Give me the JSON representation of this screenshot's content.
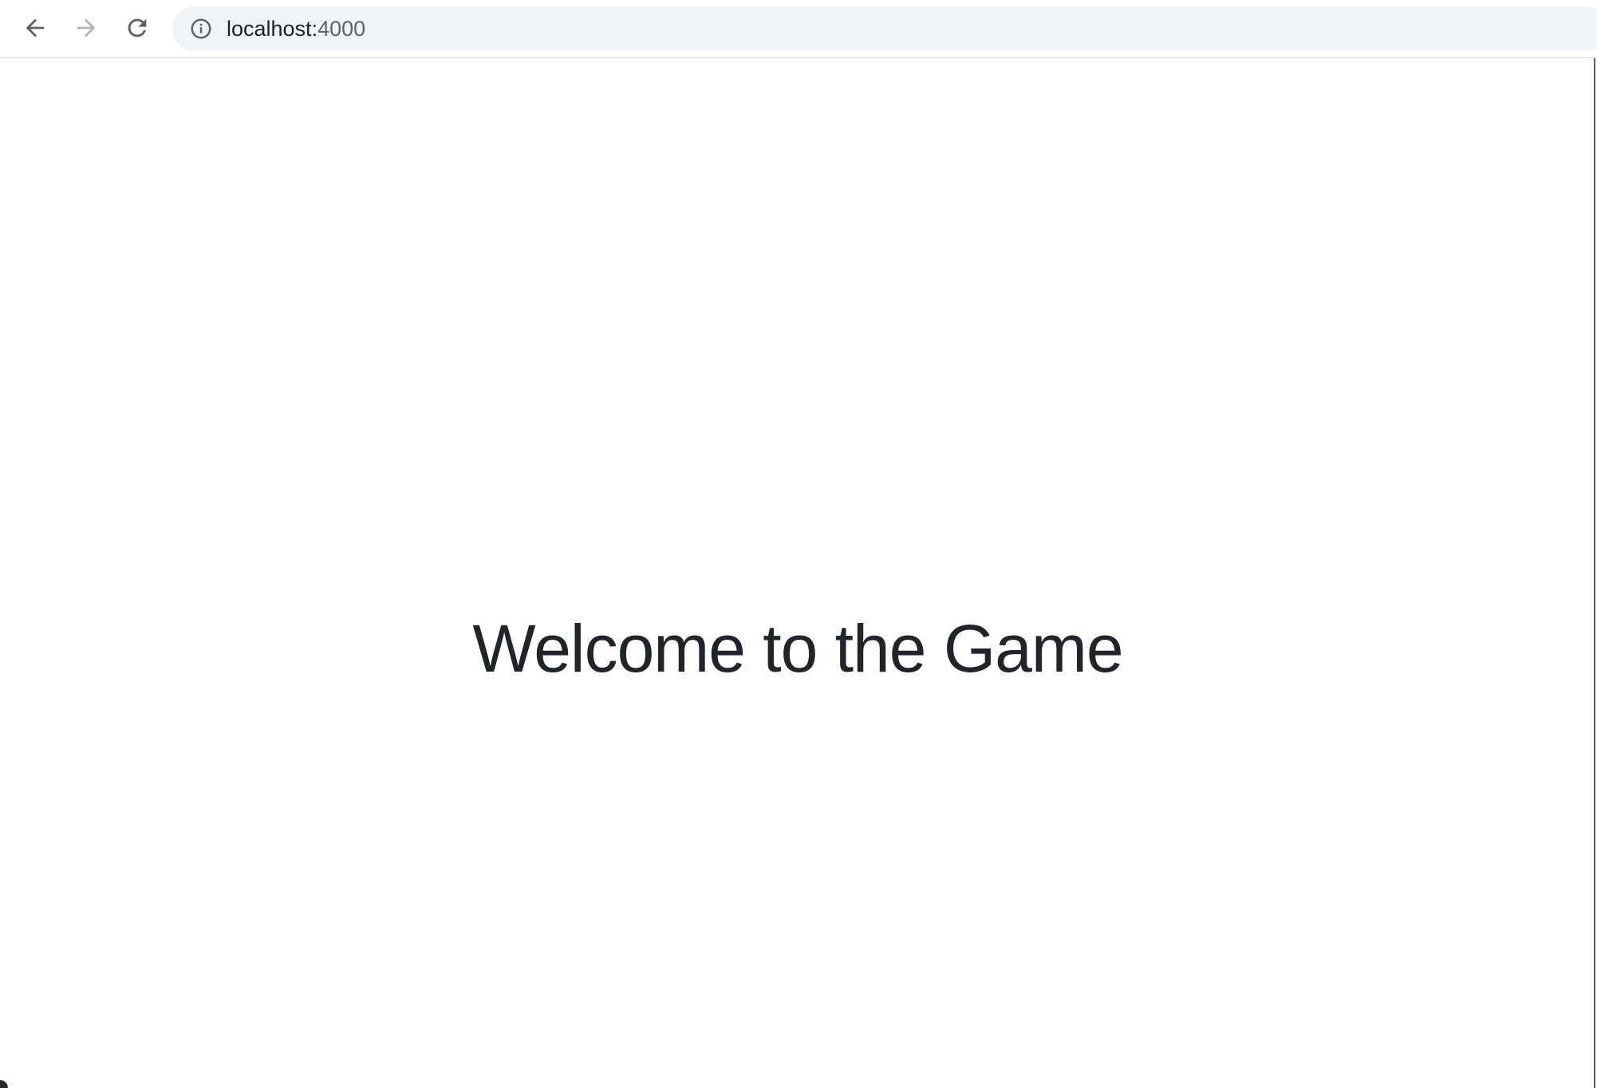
{
  "browser": {
    "url_host": "localhost:",
    "url_port": "4000",
    "back_icon": "arrow-left-icon",
    "forward_icon": "arrow-right-icon",
    "reload_icon": "reload-icon",
    "info_icon": "info-icon"
  },
  "page": {
    "heading": "Welcome to the Game"
  },
  "colors": {
    "heading_text": "#212529",
    "omnibox_bg": "#f1f3f4",
    "port_text": "#5f6368"
  }
}
